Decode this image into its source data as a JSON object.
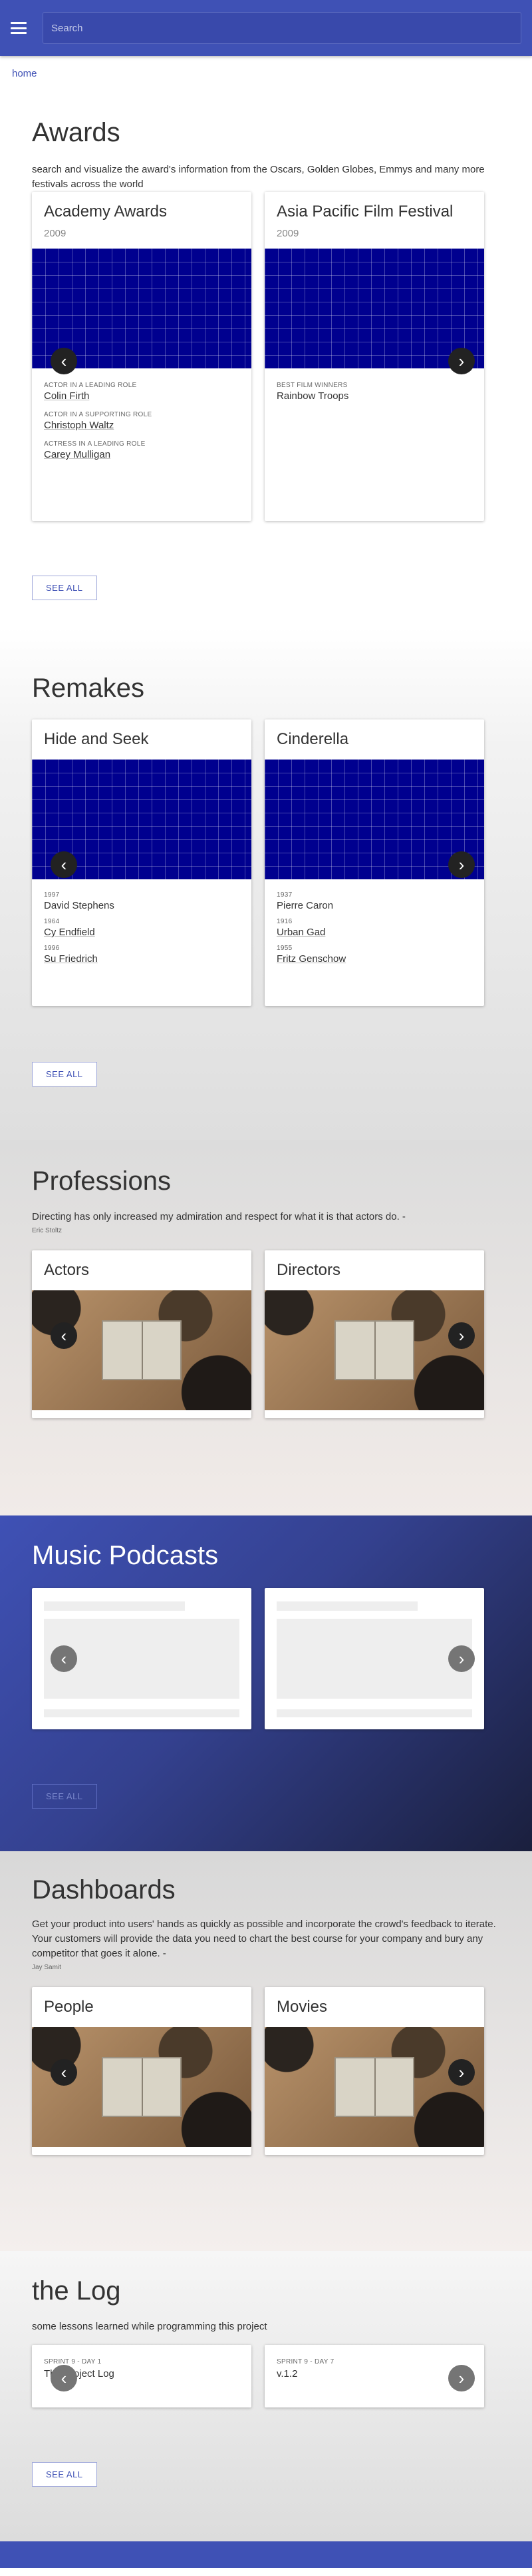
{
  "topbar": {
    "search_placeholder": "Search"
  },
  "breadcrumb": "home",
  "awards": {
    "title": "Awards",
    "description": "search and visualize the award's information from the Oscars, Golden Globes, Emmys and many more festivals across the world",
    "cards": [
      {
        "title": "Academy Awards",
        "year": "2009",
        "entries": [
          {
            "label": "ACTOR IN A LEADING ROLE",
            "value": "Colin Firth"
          },
          {
            "label": "ACTOR IN A SUPPORTING ROLE",
            "value": "Christoph Waltz"
          },
          {
            "label": "ACTRESS IN A LEADING ROLE",
            "value": "Carey Mulligan"
          }
        ]
      },
      {
        "title": "Asia Pacific Film Festival",
        "year": "2009",
        "entries": [
          {
            "label": "BEST FILM WINNERS",
            "value": "Rainbow Troops"
          }
        ]
      }
    ],
    "see_all": "SEE ALL"
  },
  "remakes": {
    "title": "Remakes",
    "cards": [
      {
        "title": "Hide and Seek",
        "entries": [
          {
            "label": "1997",
            "value": "David Stephens"
          },
          {
            "label": "1964",
            "value": "Cy Endfield"
          },
          {
            "label": "1996",
            "value": "Su Friedrich"
          }
        ]
      },
      {
        "title": "Cinderella",
        "entries": [
          {
            "label": "1937",
            "value": "Pierre Caron"
          },
          {
            "label": "1916",
            "value": "Urban Gad"
          },
          {
            "label": "1955",
            "value": "Fritz Genschow"
          }
        ]
      }
    ],
    "see_all": "SEE ALL"
  },
  "professions": {
    "title": "Professions",
    "quote": "Directing has only increased my admiration and respect for what it is that actors do. -",
    "author": "Eric Stoltz",
    "cards": [
      {
        "title": "Actors"
      },
      {
        "title": "Directors"
      }
    ]
  },
  "podcasts": {
    "title": "Music Podcasts",
    "see_all": "SEE ALL"
  },
  "dashboards": {
    "title": "Dashboards",
    "quote": "Get your product into users' hands as quickly as possible and incorporate the crowd's feedback to iterate. Your customers will provide the data you need to chart the best course for your company and bury any competitor that goes it alone. -",
    "author": "Jay Samit",
    "cards": [
      {
        "title": "People"
      },
      {
        "title": "Movies"
      }
    ]
  },
  "log": {
    "title": "the Log",
    "description": "some lessons learned while programming this project",
    "cards": [
      {
        "label": "SPRINT 9 - DAY 1",
        "value": "The Project Log"
      },
      {
        "label": "SPRINT 9 - DAY 7",
        "value": "v.1.2"
      }
    ],
    "see_all": "SEE ALL"
  },
  "icons": {
    "prev": "chevron-left-icon",
    "next": "chevron-right-icon",
    "menu": "menu-icon"
  },
  "colors": {
    "primary": "#3f51b5",
    "grid_blue": "#00008f",
    "podcast_dark": "#1a1f3d"
  }
}
